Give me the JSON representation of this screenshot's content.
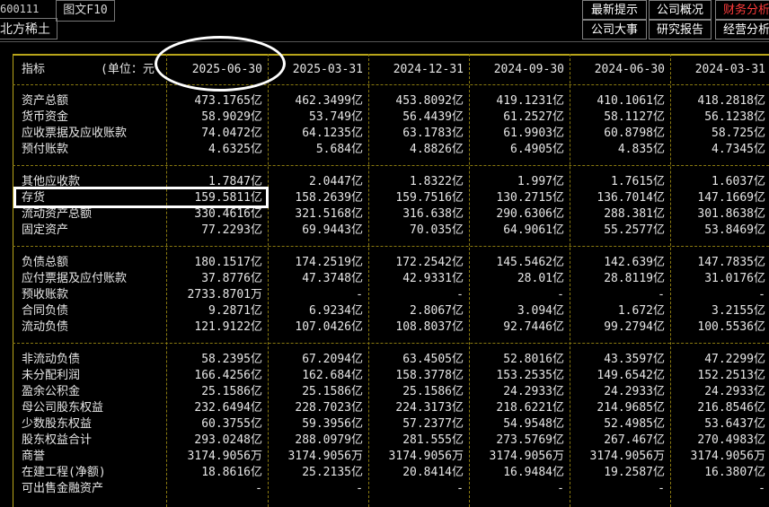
{
  "header": {
    "stock_code": "600111",
    "stock_name": "北方稀土",
    "tab_f10": "图文F10"
  },
  "menu": {
    "row1": [
      "最新提示",
      "公司概况",
      "财务分析"
    ],
    "row2": [
      "公司大事",
      "研究报告",
      "经营分析"
    ],
    "active": "财务分析"
  },
  "table": {
    "title_label": "指标",
    "unit_label": "(单位：元",
    "periods": [
      "2025-06-30",
      "2025-03-31",
      "2024-12-31",
      "2024-09-30",
      "2024-06-30",
      "2024-03-31"
    ],
    "rows": [
      {
        "label": "资产总额",
        "values": [
          "473.1765亿",
          "462.3499亿",
          "453.8092亿",
          "419.1231亿",
          "410.1061亿",
          "418.2818亿"
        ]
      },
      {
        "label": "货币资金",
        "values": [
          "58.9029亿",
          "53.749亿",
          "56.4439亿",
          "61.2527亿",
          "58.1127亿",
          "56.1238亿"
        ]
      },
      {
        "label": "应收票据及应收账款",
        "values": [
          "74.0472亿",
          "64.1235亿",
          "63.1783亿",
          "61.9903亿",
          "60.8798亿",
          "58.725亿"
        ]
      },
      {
        "label": "预付账款",
        "values": [
          "4.6325亿",
          "5.684亿",
          "4.8826亿",
          "6.4905亿",
          "4.835亿",
          "4.7345亿"
        ]
      },
      {
        "label": "其他应收款",
        "values": [
          "1.7847亿",
          "2.0447亿",
          "1.8322亿",
          "1.997亿",
          "1.7615亿",
          "1.6037亿"
        ]
      },
      {
        "label": "存货",
        "values": [
          "159.5811亿",
          "158.2639亿",
          "159.7516亿",
          "130.2715亿",
          "136.7014亿",
          "147.1669亿"
        ]
      },
      {
        "label": "流动资产总额",
        "values": [
          "330.4616亿",
          "321.5168亿",
          "316.638亿",
          "290.6306亿",
          "288.381亿",
          "301.8638亿"
        ]
      },
      {
        "label": "固定资产",
        "values": [
          "77.2293亿",
          "69.9443亿",
          "70.035亿",
          "64.9061亿",
          "55.2577亿",
          "53.8469亿"
        ]
      },
      {
        "label": "负债总额",
        "values": [
          "180.1517亿",
          "174.2519亿",
          "172.2542亿",
          "145.5462亿",
          "142.639亿",
          "147.7835亿"
        ]
      },
      {
        "label": "应付票据及应付账款",
        "values": [
          "37.8776亿",
          "47.3748亿",
          "42.9331亿",
          "28.01亿",
          "28.8119亿",
          "31.0176亿"
        ]
      },
      {
        "label": "预收账款",
        "values": [
          "2733.8701万",
          "-",
          "-",
          "-",
          "-",
          "-"
        ]
      },
      {
        "label": "合同负债",
        "values": [
          "9.2871亿",
          "6.9234亿",
          "2.8067亿",
          "3.094亿",
          "1.672亿",
          "3.2155亿"
        ]
      },
      {
        "label": "流动负债",
        "values": [
          "121.9122亿",
          "107.0426亿",
          "108.8037亿",
          "92.7446亿",
          "99.2794亿",
          "100.5536亿"
        ]
      },
      {
        "label": "非流动负债",
        "values": [
          "58.2395亿",
          "67.2094亿",
          "63.4505亿",
          "52.8016亿",
          "43.3597亿",
          "47.2299亿"
        ]
      },
      {
        "label": "未分配利润",
        "values": [
          "166.4256亿",
          "162.684亿",
          "158.3778亿",
          "153.2535亿",
          "149.6542亿",
          "152.2513亿"
        ]
      },
      {
        "label": "盈余公积金",
        "values": [
          "25.1586亿",
          "25.1586亿",
          "25.1586亿",
          "24.2933亿",
          "24.2933亿",
          "24.2933亿"
        ]
      },
      {
        "label": "母公司股东权益",
        "values": [
          "232.6494亿",
          "228.7023亿",
          "224.3173亿",
          "218.6221亿",
          "214.9685亿",
          "216.8546亿"
        ]
      },
      {
        "label": "少数股东权益",
        "values": [
          "60.3755亿",
          "59.3956亿",
          "57.2377亿",
          "54.9548亿",
          "52.4985亿",
          "53.6437亿"
        ]
      },
      {
        "label": "股东权益合计",
        "values": [
          "293.0248亿",
          "288.0979亿",
          "281.555亿",
          "273.5769亿",
          "267.467亿",
          "270.4983亿"
        ]
      },
      {
        "label": "商誉",
        "values": [
          "3174.9056万",
          "3174.9056万",
          "3174.9056万",
          "3174.9056万",
          "3174.9056万",
          "3174.9056万"
        ]
      },
      {
        "label": "在建工程(净额)",
        "values": [
          "18.8616亿",
          "25.2135亿",
          "20.8414亿",
          "16.9484亿",
          "19.2587亿",
          "16.3807亿"
        ]
      },
      {
        "label": "可出售金融资产",
        "values": [
          "-",
          "-",
          "-",
          "-",
          "-",
          "-"
        ]
      }
    ]
  }
}
